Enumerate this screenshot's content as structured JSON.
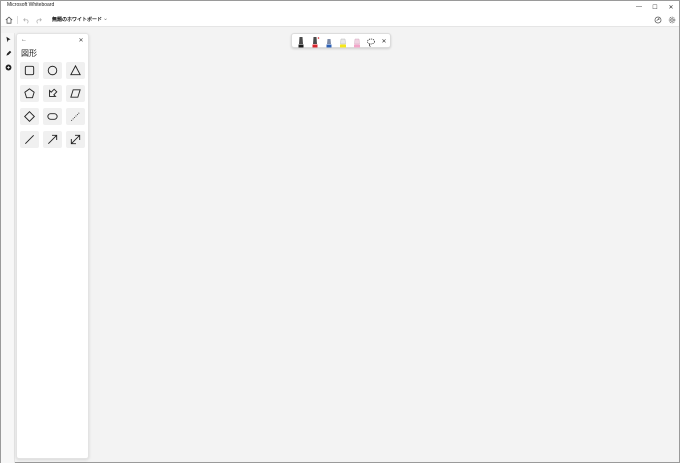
{
  "window": {
    "title": "Microsoft Whiteboard",
    "minimize_glyph": "—",
    "maximize_glyph": "☐",
    "close_glyph": "✕"
  },
  "appbar": {
    "board_name": "無題のホワイトボード",
    "board_chevron": "⌄",
    "home_icon": "home-icon",
    "undo_icon": "undo-icon",
    "redo_icon": "redo-icon",
    "share_icon": "share-icon",
    "settings_icon": "gear-icon"
  },
  "rail": {
    "items": [
      {
        "icon": "select-pointer-icon"
      },
      {
        "icon": "pen-icon"
      },
      {
        "icon": "add-circle-icon"
      }
    ]
  },
  "shapes_panel": {
    "back_glyph": "←",
    "close_glyph": "✕",
    "heading": "図形",
    "shapes": [
      "rectangle",
      "circle",
      "triangle",
      "pentagon",
      "arrow-pentagon",
      "parallelogram",
      "diamond",
      "rounded-rect",
      "dotted-line",
      "line",
      "arrow",
      "double-arrow"
    ]
  },
  "ink_toolbar": {
    "pens": [
      {
        "name": "black-pen",
        "color": "#1a1a1a"
      },
      {
        "name": "red-pen",
        "color": "#d8242c"
      },
      {
        "name": "blue-pen",
        "color": "#2b5fb4"
      },
      {
        "name": "yellow-highlighter",
        "color": "#f6e71a"
      },
      {
        "name": "pink-highlighter",
        "color": "#f3a5c9"
      }
    ],
    "lasso_icon": "lasso-icon",
    "close_glyph": "✕"
  },
  "colors": {
    "canvas": "#f3f3f3",
    "panel": "#ffffff",
    "shape_tile": "#f0f0f0"
  }
}
